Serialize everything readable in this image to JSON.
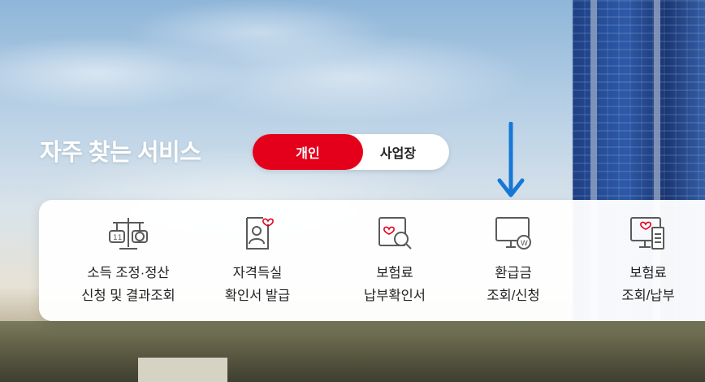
{
  "header": {
    "title": "자주 찾는 서비스"
  },
  "toggle": {
    "active_label": "개인",
    "inactive_label": "사업장"
  },
  "colors": {
    "accent": "#e4001b",
    "arrow": "#1677d6",
    "icon": "#5a5a5a",
    "icon_accent": "#e4001b"
  },
  "services": [
    {
      "icon": "scale-icon",
      "line1": "소득 조정·정산",
      "line2": "신청 및 결과조회"
    },
    {
      "icon": "certificate-person-icon",
      "line1": "자격득실",
      "line2": "확인서 발급"
    },
    {
      "icon": "search-document-icon",
      "line1": "보험료",
      "line2": "납부확인서"
    },
    {
      "icon": "monitor-coin-icon",
      "line1": "환급금",
      "line2": "조회/신청"
    },
    {
      "icon": "computer-receipt-icon",
      "line1": "보험료",
      "line2": "조회/납부"
    }
  ]
}
